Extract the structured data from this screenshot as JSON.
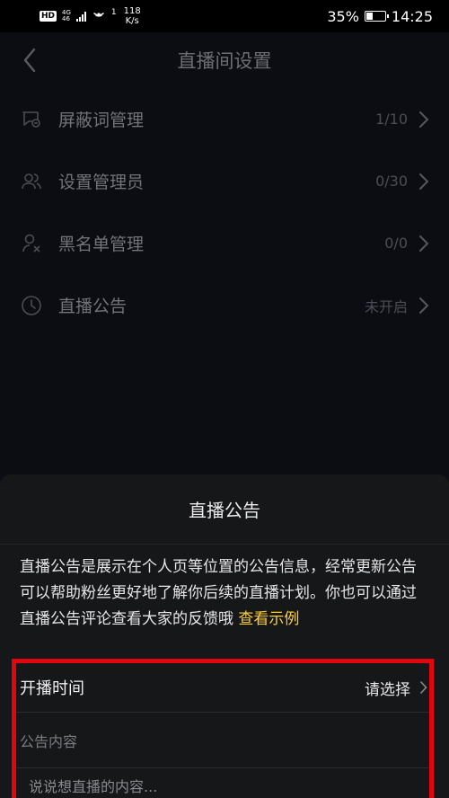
{
  "status_bar": {
    "hd": "HD",
    "network_type": "4G",
    "network_sub": "46",
    "hotspot": "1",
    "speed_value": "118",
    "speed_unit": "K/s",
    "battery": "35%",
    "battery_level": 0.35,
    "time": "14:25"
  },
  "header": {
    "title": "直播间设置"
  },
  "settings": {
    "items": [
      {
        "label": "屏蔽词管理",
        "value": "1/10",
        "icon": "blocked-words-icon"
      },
      {
        "label": "设置管理员",
        "value": "0/30",
        "icon": "admin-users-icon"
      },
      {
        "label": "黑名单管理",
        "value": "0/0",
        "icon": "blacklist-user-icon"
      },
      {
        "label": "直播公告",
        "value": "未开启",
        "icon": "clock-icon"
      }
    ]
  },
  "sheet": {
    "title": "直播公告",
    "description": "直播公告是展示在个人页等位置的公告信息，经常更新公告可以帮助粉丝更好地了解你后续的直播计划。你也可以通过直播公告评论查看大家的反馈哦",
    "example_link": "查看示例",
    "link_color": "#fece2e"
  },
  "form": {
    "start_time_label": "开播时间",
    "start_time_value": "请选择",
    "content_label": "公告内容",
    "content_placeholder": "说说想直播的内容...",
    "highlight_color": "#e3050d"
  }
}
